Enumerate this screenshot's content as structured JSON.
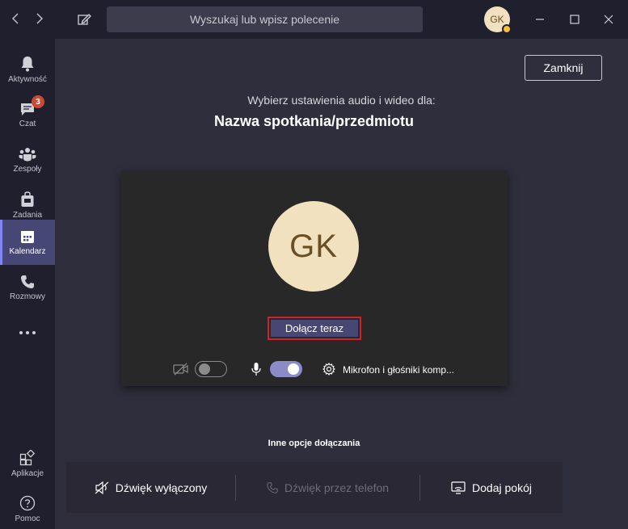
{
  "titlebar": {
    "search_placeholder": "Wyszukaj lub wpisz polecenie",
    "user_initials": "GK",
    "status_color": "#f8c13a"
  },
  "rail": {
    "items": [
      {
        "label": "Aktywność",
        "icon": "bell-icon"
      },
      {
        "label": "Czat",
        "icon": "chat-icon",
        "badge": "3"
      },
      {
        "label": "Zespoły",
        "icon": "teams-icon"
      },
      {
        "label": "Zadania",
        "icon": "bag-icon"
      },
      {
        "label": "Kalendarz",
        "icon": "calendar-icon",
        "active": true
      },
      {
        "label": "Rozmowy",
        "icon": "phone-icon"
      },
      {
        "label": "Aplikacje",
        "icon": "apps-icon"
      },
      {
        "label": "Pomoc",
        "icon": "help-icon"
      }
    ]
  },
  "main": {
    "close_label": "Zamknij",
    "subtitle": "Wybierz ustawienia audio i wideo dla:",
    "meeting_title": "Nazwa spotkania/przedmiotu",
    "avatar_initials": "GK",
    "join_label": "Dołącz teraz",
    "camera_on": false,
    "mic_on": true,
    "audio_device_label": "Mikrofon i głośniki komp...",
    "other_options_title": "Inne opcje dołączania",
    "options": [
      {
        "label": "Dźwięk wyłączony",
        "icon": "speaker-off-icon",
        "enabled": true
      },
      {
        "label": "Dźwięk przez telefon",
        "icon": "phone-icon",
        "enabled": false
      },
      {
        "label": "Dodaj pokój",
        "icon": "room-cast-icon",
        "enabled": true
      }
    ]
  },
  "colors": {
    "accent": "#464775",
    "rail_bg": "#201f2d",
    "main_bg": "#2f2e3c",
    "highlight": "#d1222c"
  }
}
